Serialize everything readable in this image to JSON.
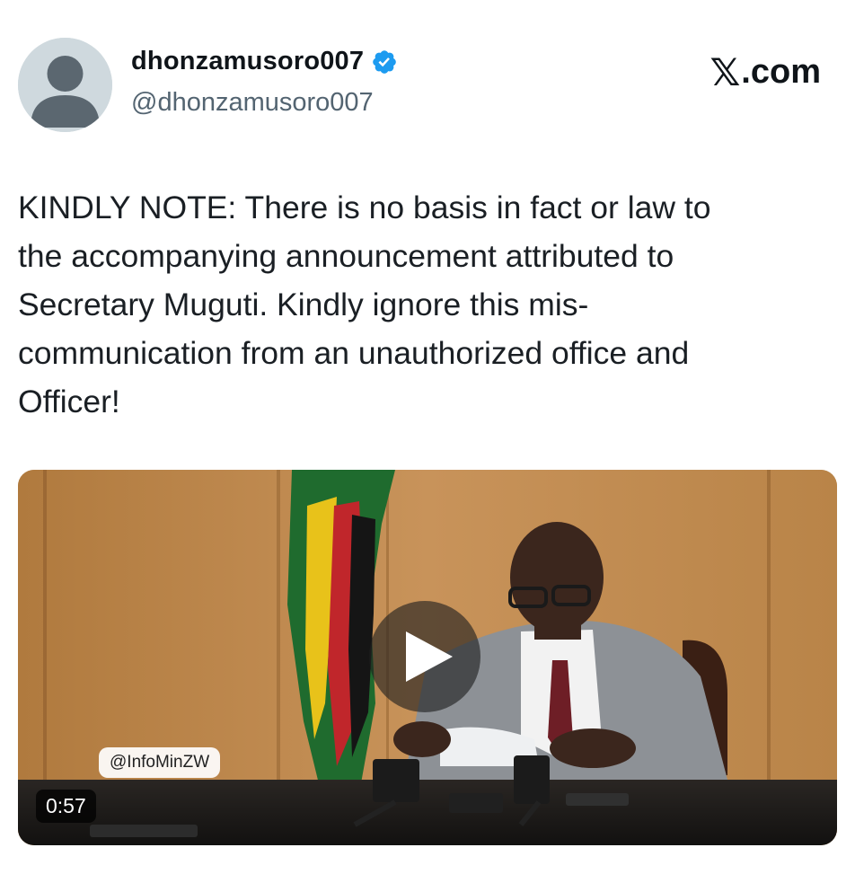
{
  "author": {
    "display_name": "dhonzamusoro007",
    "handle": "@dhonzamusoro007",
    "verified": true,
    "avatar_icon": "default-avatar-icon"
  },
  "brand": {
    "name": ".com",
    "icon": "x-logo-icon"
  },
  "tweet": {
    "text": "KINDLY NOTE: There is no basis in fact or law to\nthe accompanying announcement attributed to\nSecretary Muguti. Kindly ignore this mis-\ncommunication from an unauthorized office and\nOfficer!"
  },
  "video": {
    "watermark": "@InfoMinZW",
    "duration": "0:57",
    "play_icon": "play-icon"
  },
  "colors": {
    "verified_badge": "#1d9bf0",
    "handle_text": "#536471",
    "avatar_bg": "#cfd9de"
  }
}
